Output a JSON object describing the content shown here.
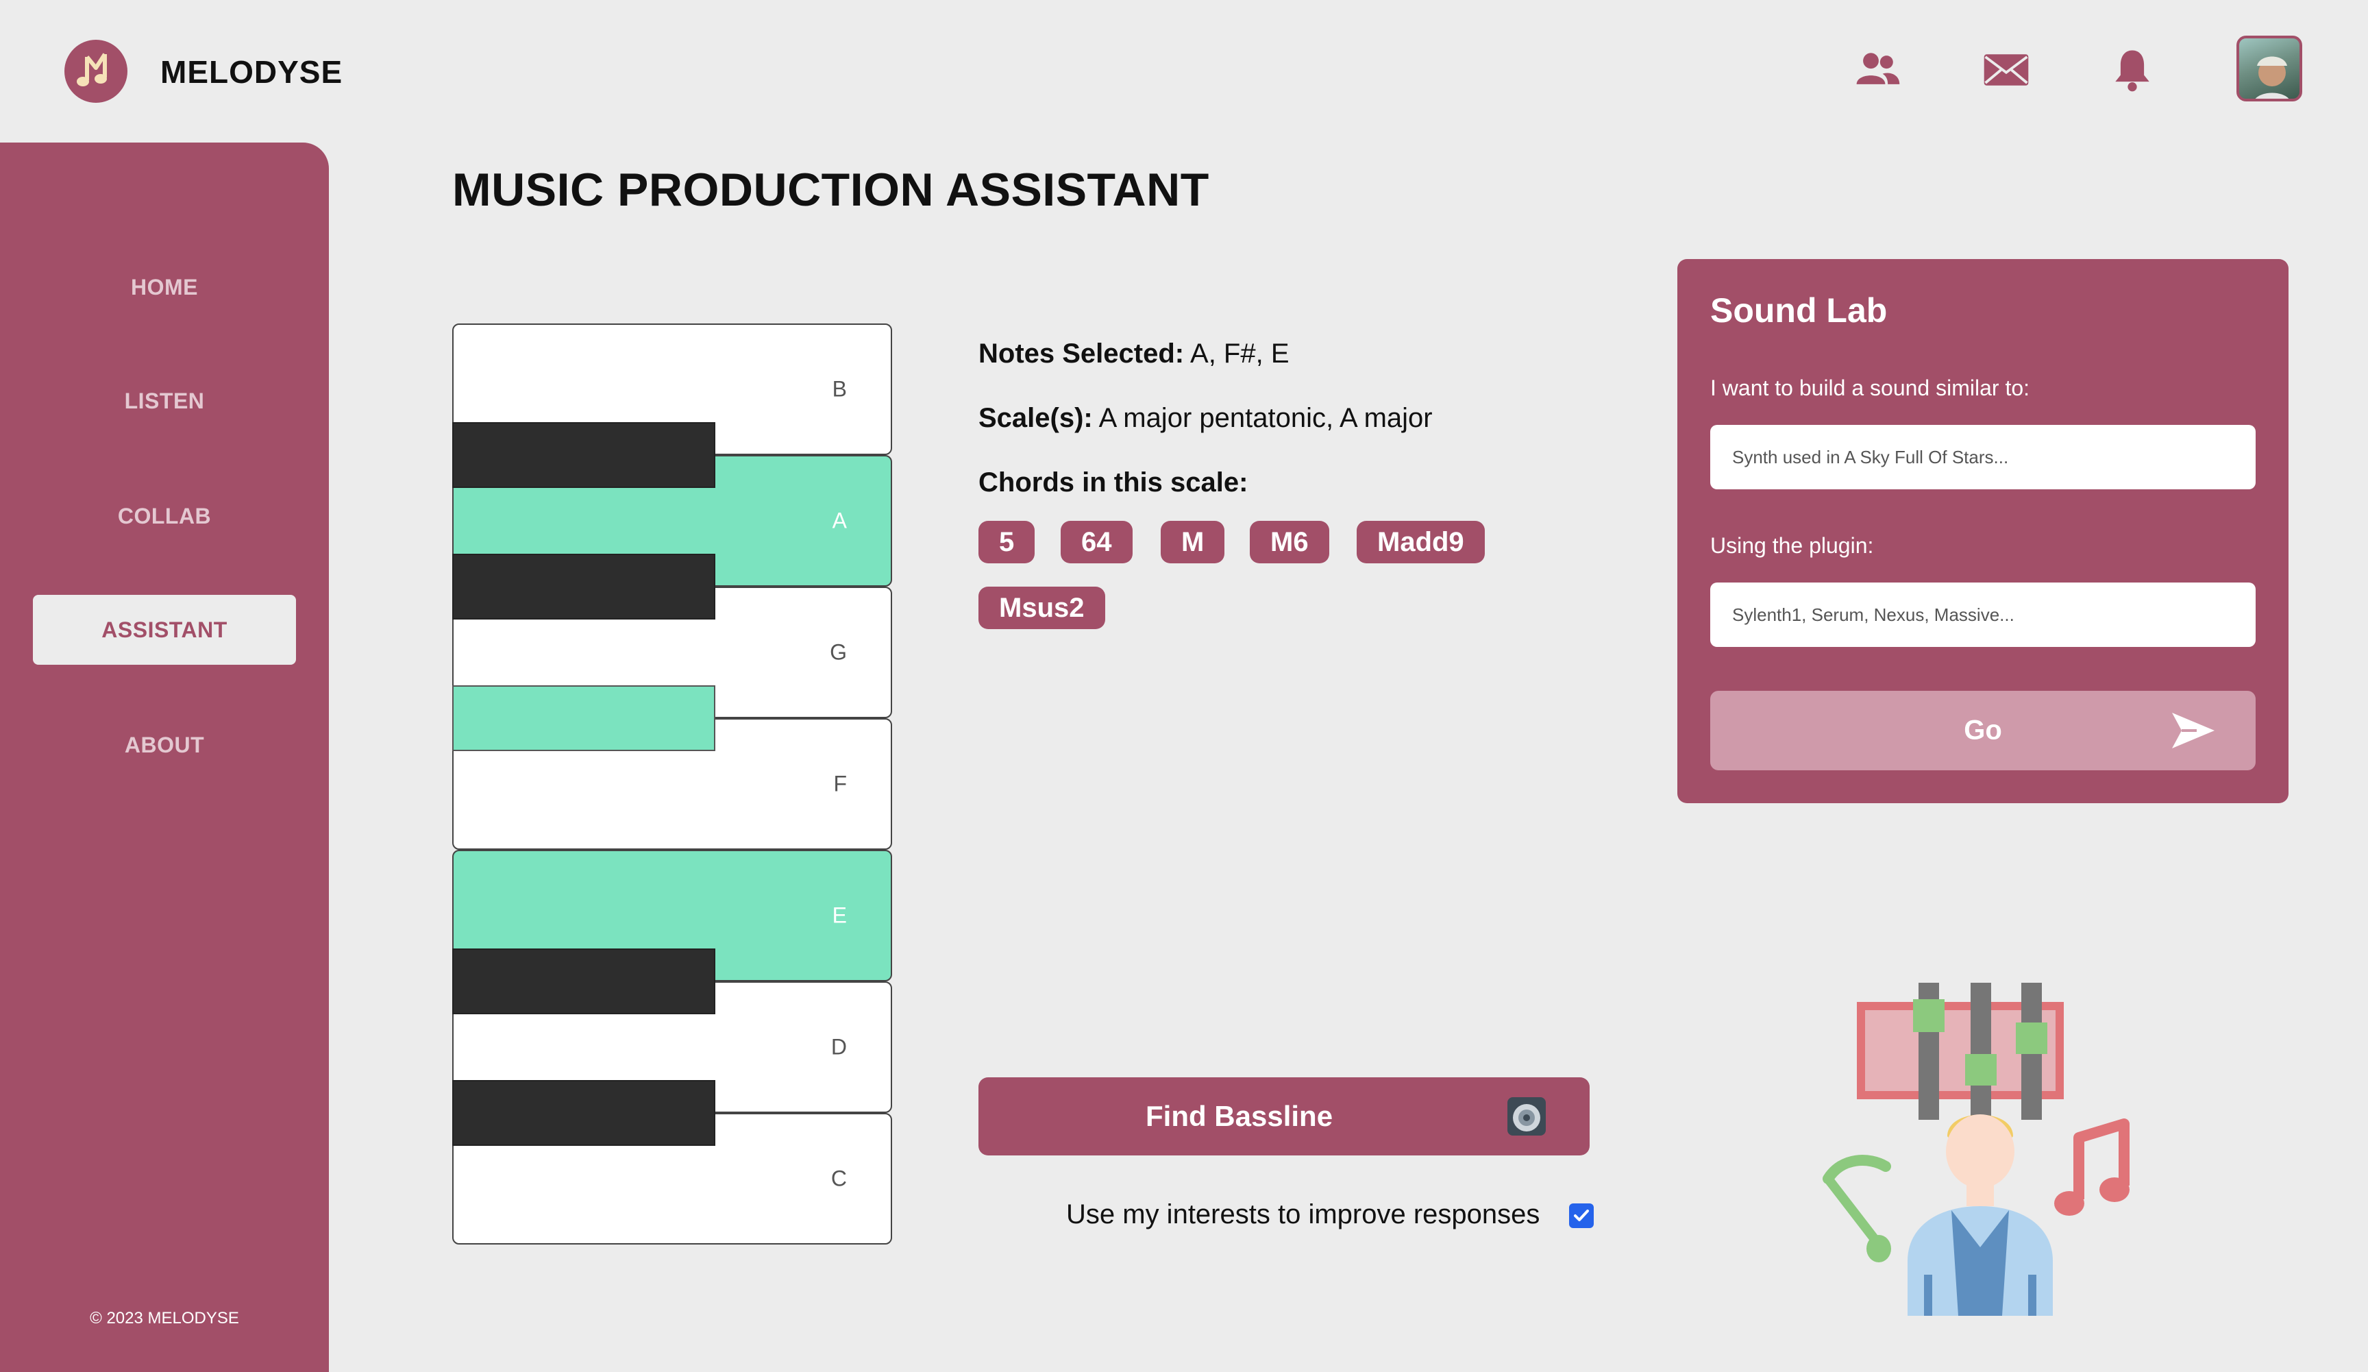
{
  "header": {
    "brand": "MELODYSE",
    "icons": [
      "users-icon",
      "mail-icon",
      "bell-icon",
      "avatar"
    ]
  },
  "sidebar": {
    "items": [
      {
        "label": "HOME"
      },
      {
        "label": "LISTEN"
      },
      {
        "label": "COLLAB"
      },
      {
        "label": "ASSISTANT",
        "active": true
      },
      {
        "label": "ABOUT"
      }
    ],
    "copyright": "© 2023 MELODYSE"
  },
  "main": {
    "title": "MUSIC PRODUCTION ASSISTANT",
    "piano": {
      "white_keys": [
        {
          "label": "B",
          "selected": false
        },
        {
          "label": "A",
          "selected": true
        },
        {
          "label": "G",
          "selected": false
        },
        {
          "label": "F",
          "selected": false
        },
        {
          "label": "E",
          "selected": true
        },
        {
          "label": "D",
          "selected": false
        },
        {
          "label": "C",
          "selected": false
        }
      ],
      "black_keys": [
        {
          "note": "A#",
          "selected": false
        },
        {
          "note": "G#",
          "selected": false
        },
        {
          "note": "F#",
          "selected": true
        },
        {
          "note": "D#",
          "selected": false
        },
        {
          "note": "C#",
          "selected": false
        }
      ]
    },
    "notes_selected_label": "Notes Selected:",
    "notes_selected_value": "A, F#, E",
    "scales_label": "Scale(s):",
    "scales_value": "A major pentatonic, A major",
    "chords_label": "Chords in this scale:",
    "chords": [
      "5",
      "64",
      "M",
      "M6",
      "Madd9",
      "Msus2"
    ],
    "find_bassline_label": "Find Bassline",
    "interests_label": "Use my interests to improve responses",
    "interests_checked": true
  },
  "sound_lab": {
    "title": "Sound Lab",
    "similar_label": "I want to build a sound similar to:",
    "similar_placeholder": "Synth used in A Sky Full Of Stars...",
    "plugin_label": "Using the plugin:",
    "plugin_placeholder": "Sylenth1, Serum, Nexus, Massive...",
    "go_label": "Go"
  },
  "colors": {
    "brand": "#a24f68",
    "selected_key": "#7be3bf",
    "background": "#ececec"
  }
}
